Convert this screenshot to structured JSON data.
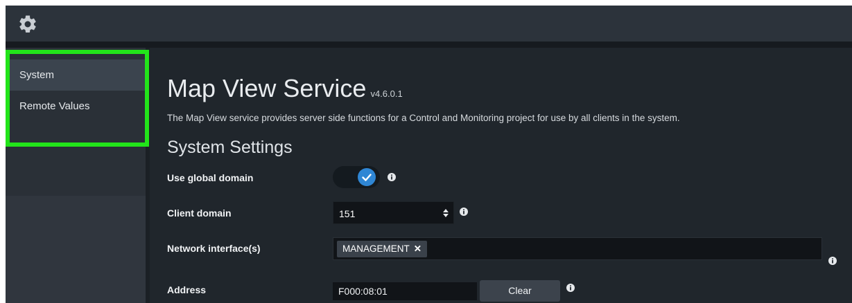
{
  "sidebar": {
    "items": [
      {
        "label": "System",
        "active": true
      },
      {
        "label": "Remote Values",
        "active": false
      }
    ]
  },
  "header": {
    "icon": "gear-icon"
  },
  "main": {
    "title": "Map View Service",
    "version": "v4.6.0.1",
    "description": "The Map View service provides server side functions for a Control and Monitoring project for use by all clients in the system.",
    "section_title": "System Settings",
    "fields": {
      "use_global_domain": {
        "label": "Use global domain",
        "value": true
      },
      "client_domain": {
        "label": "Client domain",
        "value": "151"
      },
      "network_interfaces": {
        "label": "Network interface(s)",
        "tags": [
          "MANAGEMENT"
        ]
      },
      "address": {
        "label": "Address",
        "value": "F000:08:01",
        "clear_label": "Clear"
      }
    }
  },
  "colors": {
    "accent": "#2f86d4",
    "highlight": "#22e41a",
    "background": "#20262c"
  }
}
